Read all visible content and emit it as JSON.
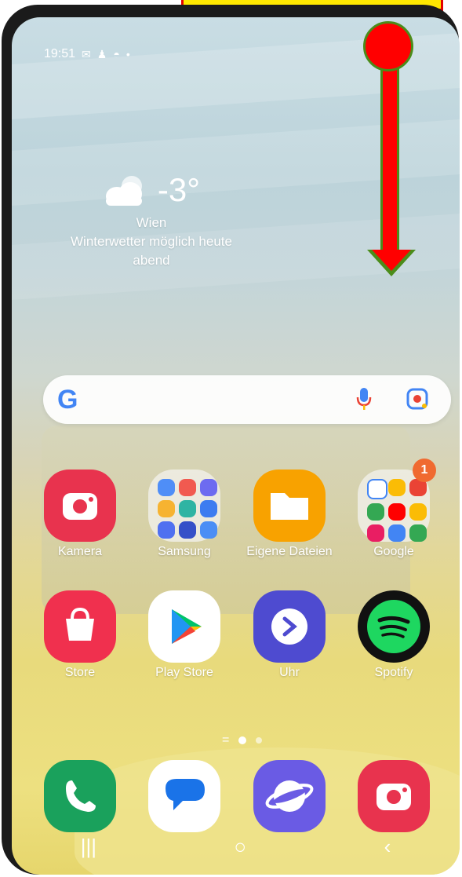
{
  "status_bar": {
    "time": "19:51",
    "icons": [
      "mail-icon",
      "person-icon",
      "incognito-icon",
      "dot-icon"
    ]
  },
  "weather": {
    "temperature": "-3°",
    "location": "Wien",
    "description": "Winterwetter möglich heute abend"
  },
  "search_bar": {
    "logo": "G"
  },
  "apps_row1": [
    {
      "label": "Kamera"
    },
    {
      "label": "Samsung"
    },
    {
      "label": "Eigene Dateien"
    },
    {
      "label": "Google",
      "badge": "1"
    }
  ],
  "apps_row2": [
    {
      "label": "Store"
    },
    {
      "label": "Play Store"
    },
    {
      "label": "Uhr"
    },
    {
      "label": "Spotify"
    }
  ],
  "colors": {
    "overlay_red": "#ff0000",
    "overlay_green": "#4b8c1a",
    "top_box_fill": "#ffe800",
    "top_box_border": "#e30000"
  }
}
